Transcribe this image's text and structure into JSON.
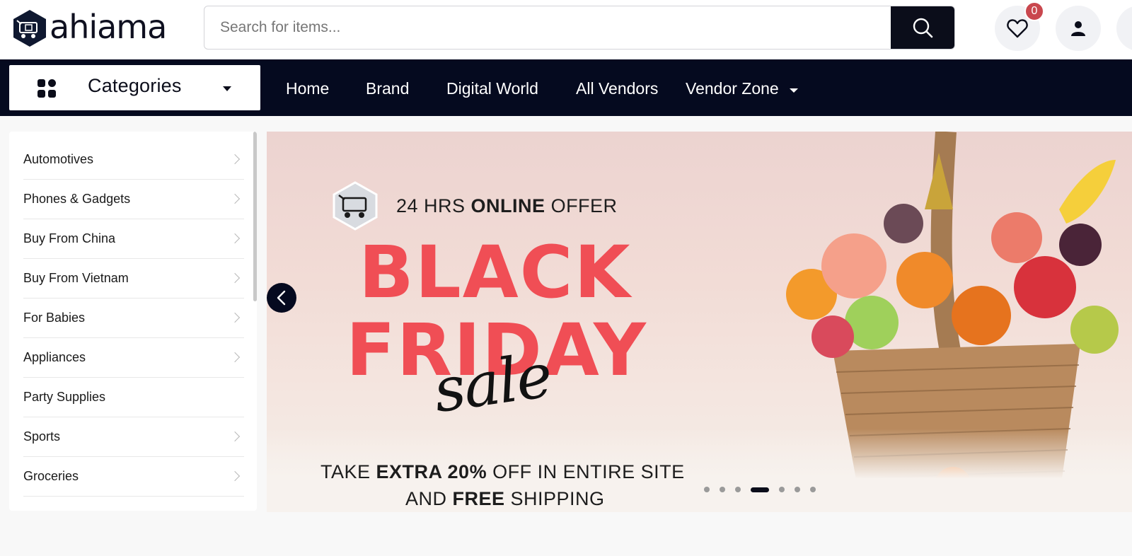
{
  "brand": {
    "name": "ahiama"
  },
  "search": {
    "placeholder": "Search for items..."
  },
  "header": {
    "wishlist_count": "0"
  },
  "nav": {
    "categories_label": "Categories",
    "links": [
      "Home",
      "Brand",
      "Digital World",
      "All Vendors",
      "Vendor Zone"
    ]
  },
  "sidebar": {
    "items": [
      {
        "label": "Automotives",
        "has_children": true
      },
      {
        "label": "Phones & Gadgets",
        "has_children": true
      },
      {
        "label": "Buy From China",
        "has_children": true
      },
      {
        "label": "Buy From Vietnam",
        "has_children": true
      },
      {
        "label": "For Babies",
        "has_children": true
      },
      {
        "label": "Appliances",
        "has_children": true
      },
      {
        "label": "Party Supplies",
        "has_children": false
      },
      {
        "label": "Sports",
        "has_children": true
      },
      {
        "label": "Groceries",
        "has_children": true
      }
    ]
  },
  "banner": {
    "offer_prefix": "24 HRS ",
    "offer_bold": "ONLINE",
    "offer_suffix": " OFFER",
    "headline_line1": "BLACK",
    "headline_line2": "FRIDAY",
    "script_word": "sale",
    "promo_line1_prefix": "TAKE ",
    "promo_line1_bold": "EXTRA 20%",
    "promo_line1_suffix": " OFF IN ENTIRE SITE",
    "promo_line2_prefix": "AND ",
    "promo_line2_bold": "FREE",
    "promo_line2_suffix": " SHIPPING",
    "slide_count": 7,
    "active_slide": 3
  },
  "colors": {
    "nav_bg": "#050a1f",
    "accent_red": "#f04e55",
    "badge_red": "#c9474e"
  },
  "icons": [
    "logo-mark-icon",
    "search-icon",
    "heart-icon",
    "user-icon",
    "grid-icon",
    "caret-down-icon",
    "chevron-right-icon",
    "chevron-left-icon"
  ]
}
